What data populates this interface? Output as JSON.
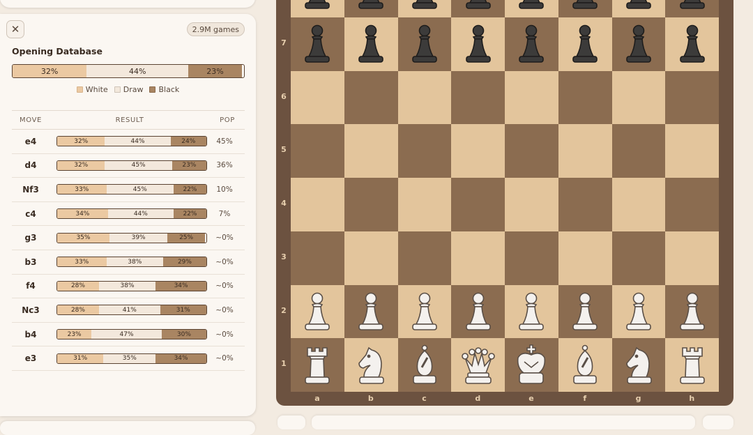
{
  "panel": {
    "close_icon": "close-icon",
    "close_glyph": "✕",
    "games_badge": "2.9M games",
    "title": "Opening Database"
  },
  "summary": {
    "white": "32%",
    "draw": "44%",
    "black": "23%",
    "white_pct": 32,
    "draw_pct": 44,
    "black_pct": 23
  },
  "legend": {
    "white": "White",
    "draw": "Draw",
    "black": "Black"
  },
  "colors": {
    "white_seg": "#ebc9a2",
    "draw_seg": "#f3e8dc",
    "black_seg": "#a98562",
    "light_square": "#e3c59c",
    "dark_square": "#8b6c50",
    "frame": "#6c5240"
  },
  "table": {
    "headers": {
      "move": "MOVE",
      "result": "RESULT",
      "pop": "POP"
    },
    "rows": [
      {
        "move": "e4",
        "white": 32,
        "draw": 44,
        "black": 24,
        "pop": "45%"
      },
      {
        "move": "d4",
        "white": 32,
        "draw": 45,
        "black": 23,
        "pop": "36%"
      },
      {
        "move": "Nf3",
        "white": 33,
        "draw": 45,
        "black": 22,
        "pop": "10%"
      },
      {
        "move": "c4",
        "white": 34,
        "draw": 44,
        "black": 22,
        "pop": "7%"
      },
      {
        "move": "g3",
        "white": 35,
        "draw": 39,
        "black": 25,
        "pop": "~0%"
      },
      {
        "move": "b3",
        "white": 33,
        "draw": 38,
        "black": 29,
        "pop": "~0%"
      },
      {
        "move": "f4",
        "white": 28,
        "draw": 38,
        "black": 34,
        "pop": "~0%"
      },
      {
        "move": "Nc3",
        "white": 28,
        "draw": 41,
        "black": 31,
        "pop": "~0%"
      },
      {
        "move": "b4",
        "white": 23,
        "draw": 47,
        "black": 30,
        "pop": "~0%"
      },
      {
        "move": "e3",
        "white": 31,
        "draw": 35,
        "black": 34,
        "pop": "~0%"
      }
    ]
  },
  "board": {
    "ranks": [
      "7",
      "6",
      "5",
      "4",
      "3",
      "2",
      "1"
    ],
    "files": [
      "a",
      "b",
      "c",
      "d",
      "e",
      "f",
      "g",
      "h"
    ],
    "position": [
      "pppppppp",
      "pppppppp",
      "........",
      "........",
      "........",
      "........",
      "PPPPPPPP",
      "RNBQKBNR"
    ],
    "piece_names": {
      "p": "black-pawn-icon",
      "P": "white-pawn-icon",
      "R": "white-rook-icon",
      "N": "white-knight-icon",
      "B": "white-bishop-icon",
      "Q": "white-queen-icon",
      "K": "white-king-icon"
    }
  }
}
